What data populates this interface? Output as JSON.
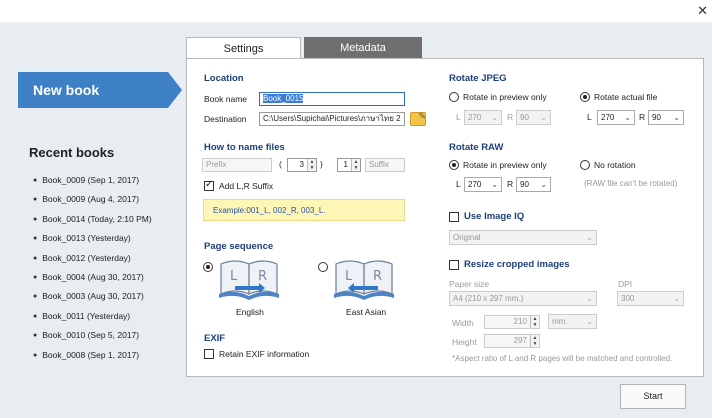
{
  "window": {
    "close_glyph": "✕"
  },
  "sidebar": {
    "new_book": "New book",
    "recent_title": "Recent books",
    "recent": [
      "Book_0009 (Sep 1, 2017)",
      "Book_0009 (Aug 4, 2017)",
      "Book_0014 (Today, 2:10 PM)",
      "Book_0013 (Yesterday)",
      "Book_0012 (Yesterday)",
      "Book_0004 (Aug 30, 2017)",
      "Book_0003 (Aug 30, 2017)",
      "Book_0011 (Yesterday)",
      "Book_0010 (Sep 5, 2017)",
      "Book_0008 (Sep 1, 2017)"
    ]
  },
  "tabs": {
    "settings": "Settings",
    "metadata": "Metadata"
  },
  "location": {
    "title": "Location",
    "book_name_label": "Book name",
    "book_name_value": "Book_0015",
    "destination_label": "Destination",
    "destination_value": "C:\\Users\\Supichai\\Pictures\\ภาษาไทย 2"
  },
  "naming": {
    "title": "How to name files",
    "prefix_placeholder": "Prefix",
    "paren_open": "(",
    "digits": "3",
    "paren_close": ")",
    "start": "1",
    "suffix_placeholder": "Suffix",
    "add_lr_label": "Add L,R Suffix",
    "add_lr_checked": true,
    "example": "Example:001_L, 002_R, 003_L."
  },
  "page_sequence": {
    "title": "Page sequence",
    "english": "English",
    "east_asian": "East Asian",
    "book_letter_l": "L",
    "book_letter_r": "R"
  },
  "exif": {
    "title": "EXIF",
    "retain_label": "Retain EXIF information"
  },
  "rotate_jpeg": {
    "title": "Rotate JPEG",
    "preview_only": "Rotate in preview only",
    "actual_file": "Rotate actual file",
    "l_label": "L",
    "r_label": "R",
    "preview_l": "270",
    "preview_r": "90",
    "actual_l": "270",
    "actual_r": "90"
  },
  "rotate_raw": {
    "title": "Rotate RAW",
    "preview_only": "Rotate in preview only",
    "no_rotation": "No rotation",
    "l_label": "L",
    "r_label": "R",
    "l_value": "270",
    "r_value": "90",
    "note": "(RAW file can't be rotated)"
  },
  "image_iq": {
    "label": "Use Image IQ",
    "value": "Original"
  },
  "resize": {
    "label": "Resize cropped images",
    "paper_size_label": "Paper size",
    "paper_size_value": "A4 (210 x 297 mm.)",
    "dpi_label": "DPI",
    "dpi_value": "300",
    "width_label": "Width",
    "width_value": "210",
    "unit": "mm.",
    "height_label": "Height",
    "height_value": "297",
    "note": "*Aspect ratio of L and R pages will be matched and controlled."
  },
  "actions": {
    "start": "Start"
  },
  "colors": {
    "accent": "#3d80c6",
    "section_title": "#1e3f7a",
    "tab_inactive": "#6f6f6f",
    "example_bg": "#fdf6b7"
  }
}
